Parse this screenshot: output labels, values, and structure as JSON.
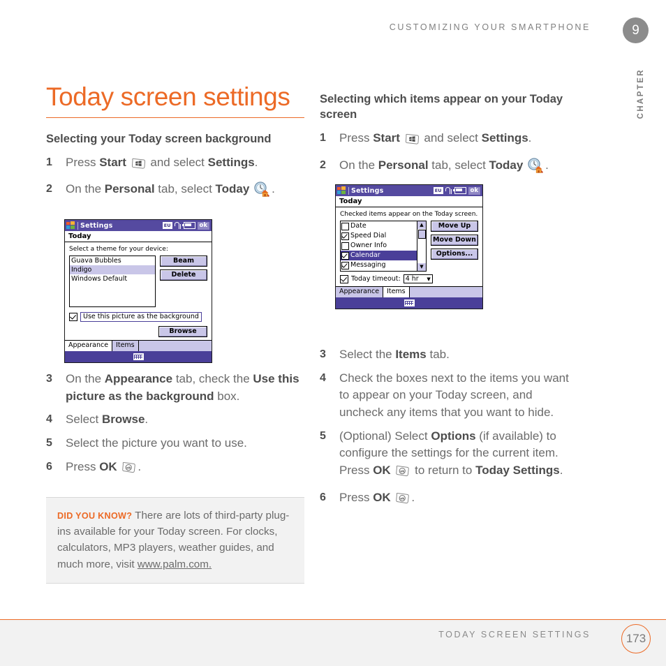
{
  "header": {
    "running_head": "CUSTOMIZING YOUR SMARTPHONE",
    "chapter_number": "9",
    "chapter_label": "CHAPTER"
  },
  "footer": {
    "running_foot": "TODAY SCREEN SETTINGS",
    "page_number": "173"
  },
  "left_column": {
    "title": "Today screen settings",
    "subheading": "Selecting your Today screen background",
    "steps": [
      {
        "num": "1",
        "parts": [
          "Press ",
          "Start",
          " ",
          "[start-key]",
          " and select ",
          "Settings",
          "."
        ]
      },
      {
        "num": "2",
        "parts": [
          "On the ",
          "Personal",
          " tab, select ",
          "Today",
          " ",
          "[today-icon]",
          "."
        ]
      },
      {
        "num": "3",
        "parts": [
          "On the ",
          "Appearance",
          " tab, check the ",
          "Use this picture as the background",
          " box."
        ]
      },
      {
        "num": "4",
        "parts": [
          "Select ",
          "Browse",
          "."
        ]
      },
      {
        "num": "5",
        "parts": [
          "Select the picture you want to use."
        ]
      },
      {
        "num": "6",
        "parts": [
          "Press ",
          "OK",
          " ",
          "[ok-key]",
          "."
        ]
      }
    ],
    "step3_text_a": "On the ",
    "step3_bold_a": "Appearance",
    "step3_text_b": " tab, check the ",
    "step3_bold_b": "Use this picture as the background",
    "step3_text_c": " box.",
    "step4_text_a": "Select ",
    "step4_bold_a": "Browse",
    "step4_text_b": ".",
    "step5_text": "Select the picture you want to use.",
    "step6_text_a": "Press ",
    "step6_bold_a": "OK",
    "step6_text_b": ".",
    "step1_text_a": "Press ",
    "step1_bold_a": "Start",
    "step1_text_b": " and select ",
    "step1_bold_b": "Settings",
    "step1_text_c": ".",
    "step2_text_a": "On the ",
    "step2_bold_a": "Personal",
    "step2_text_b": " tab, select ",
    "step2_bold_b": "Today",
    "step2_text_c": "."
  },
  "did_you_know": {
    "tag": "DID YOU KNOW?",
    "body": "There are lots of third-party plug-ins available for your Today screen. For clocks, calculators, MP3 players, weather guides, and much more, visit ",
    "link": "www.palm.com."
  },
  "right_column": {
    "subheading": "Selecting which items appear on your Today screen",
    "step1_text_a": "Press ",
    "step1_bold_a": "Start",
    "step1_text_b": " and select ",
    "step1_bold_b": "Settings",
    "step1_text_c": ".",
    "step2_text_a": "On the ",
    "step2_bold_a": "Personal",
    "step2_text_b": " tab, select ",
    "step2_bold_b": "Today",
    "step2_text_c": ".",
    "step3_text_a": "Select the ",
    "step3_bold_a": "Items",
    "step3_text_b": " tab.",
    "step4_text": "Check the boxes next to the items you want to appear on your Today screen, and uncheck any items that you want to hide.",
    "step5_text_a": "(Optional) Select ",
    "step5_bold_a": "Options",
    "step5_text_b": " (if available) to configure the settings for the current item. Press ",
    "step5_bold_b": "OK",
    "step5_text_c": " to return to ",
    "step5_bold_c": "Today Settings",
    "step5_text_d": ".",
    "step6_text_a": "Press ",
    "step6_bold_a": "OK",
    "step6_text_b": ".",
    "step_numbers": {
      "n1": "1",
      "n2": "2",
      "n3": "3",
      "n4": "4",
      "n5": "5",
      "n6": "6"
    }
  },
  "step_numbers": {
    "n1": "1",
    "n2": "2",
    "n3": "3",
    "n4": "4",
    "n5": "5",
    "n6": "6"
  },
  "device_appearance": {
    "titlebar": {
      "app_title": "Settings",
      "tray_chip": "EU",
      "ok_button": "ok"
    },
    "page_header": "Today",
    "prompt": "Select a theme for your device:",
    "themes": [
      "Guava Bubbles",
      "Indigo",
      "Windows Default"
    ],
    "selected_theme": "Indigo",
    "buttons": [
      "Beam",
      "Delete"
    ],
    "checkbox_label": "Use this picture as the background",
    "checkbox_checked": true,
    "browse_button": "Browse",
    "tabs": [
      "Appearance",
      "Items"
    ],
    "active_tab": "Appearance"
  },
  "device_items": {
    "titlebar": {
      "app_title": "Settings",
      "tray_chip": "EU",
      "ok_button": "ok"
    },
    "page_header": "Today",
    "prompt": "Checked items appear on the Today screen.",
    "items": [
      {
        "label": "Date",
        "checked": false,
        "selected": false
      },
      {
        "label": "Speed Dial",
        "checked": true,
        "selected": false
      },
      {
        "label": "Owner Info",
        "checked": false,
        "selected": false
      },
      {
        "label": "Calendar",
        "checked": true,
        "selected": true
      },
      {
        "label": "Messaging",
        "checked": true,
        "selected": false
      }
    ],
    "buttons": [
      "Move Up",
      "Move Down",
      "Options..."
    ],
    "timeout_label": "Today timeout:",
    "timeout_value": "4 hr",
    "timeout_checked": true,
    "tabs": [
      "Appearance",
      "Items"
    ],
    "active_tab": "Items"
  },
  "colors": {
    "accent_orange": "#ec6a26",
    "device_purple": "#4a3f99",
    "device_titlebar": "#554aa0",
    "device_lavender": "#c9c6e8",
    "body_gray": "#6b6b6b"
  }
}
